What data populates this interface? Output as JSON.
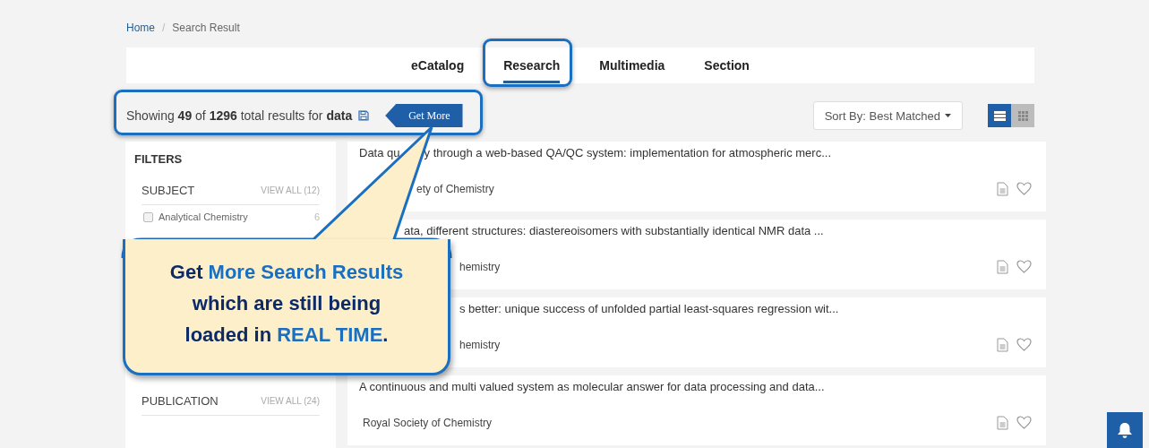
{
  "breadcrumb": {
    "items": [
      "Home",
      "Search Result"
    ],
    "separator": "/"
  },
  "tabs": [
    {
      "label": "eCatalog",
      "selected": false
    },
    {
      "label": "Research",
      "selected": true
    },
    {
      "label": "Multimedia",
      "selected": false
    },
    {
      "label": "Section",
      "selected": false
    }
  ],
  "results_summary": {
    "text": "Showing **49** of **1296** total results for **data**",
    "get_more_button": "Get More"
  },
  "sort": {
    "label": "Sort By: Best Matched"
  },
  "view_toggle": [
    {
      "kind": "list",
      "selected": true
    },
    {
      "kind": "grid",
      "selected": false
    }
  ],
  "filters": {
    "title": "FILTERS",
    "groups": [
      {
        "name": "SUBJECT",
        "view_all": "VIEW ALL (12)",
        "items": [
          {
            "label": "Analytical Chemistry",
            "count": "6",
            "checked": false
          }
        ]
      },
      {
        "name": "PUBLICATION",
        "view_all": "VIEW ALL (24)"
      }
    ]
  },
  "results": [
    {
      "title": [
        "Data qu",
        "y through a web-based QA/QC system: implementation for atmospheric merc..."
      ],
      "publisher": "ety of Chemistry"
    },
    {
      "title": [
        "ata, different structures: diastereoisomers with substantially identical NMR data ..."
      ],
      "publisher": "hemistry"
    },
    {
      "title": [
        "s better: unique success of unfolded partial least-squares regression wit..."
      ],
      "publisher": "hemistry"
    },
    {
      "title": [
        "A continuous and multi valued system as molecular answer for data processing and data..."
      ],
      "publisher": "Royal Society of Chemistry"
    }
  ],
  "callout": {
    "segments": [
      {
        "text": "Get ",
        "highlight": false
      },
      {
        "text": "More Search Results",
        "highlight": true
      },
      {
        "text": " which are still being loaded in ",
        "highlight": false
      },
      {
        "text": "REAL TIME",
        "highlight": true
      },
      {
        "text": ".",
        "highlight": false
      }
    ]
  }
}
